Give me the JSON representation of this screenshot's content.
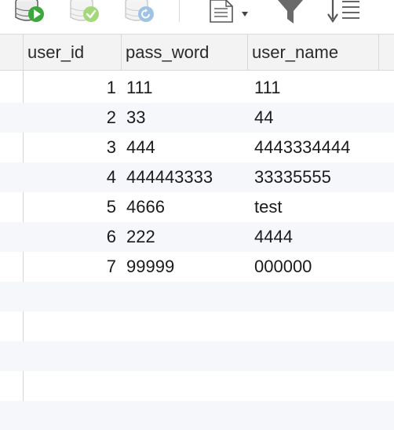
{
  "toolbar": {
    "icons": [
      "database-run-icon",
      "database-check-icon",
      "database-refresh-icon",
      "document-dropdown-icon",
      "filter-icon",
      "sort-icon"
    ]
  },
  "table": {
    "columns": [
      "user_id",
      "pass_word",
      "user_name"
    ],
    "rows": [
      {
        "user_id": "1",
        "pass_word": "111",
        "user_name": "111"
      },
      {
        "user_id": "2",
        "pass_word": "33",
        "user_name": "44"
      },
      {
        "user_id": "3",
        "pass_word": "444",
        "user_name": "4443334444"
      },
      {
        "user_id": "4",
        "pass_word": "444443333",
        "user_name": "33335555"
      },
      {
        "user_id": "5",
        "pass_word": "4666",
        "user_name": "test"
      },
      {
        "user_id": "6",
        "pass_word": "222",
        "user_name": "4444"
      },
      {
        "user_id": "7",
        "pass_word": "99999",
        "user_name": "000000"
      }
    ]
  },
  "colors": {
    "run_green": "#3aa83a",
    "check_green": "#8fd14f",
    "refresh_blue": "#8ab6e0",
    "stripe": "#f5f7fa",
    "header_bg": "#f3f3f3"
  }
}
